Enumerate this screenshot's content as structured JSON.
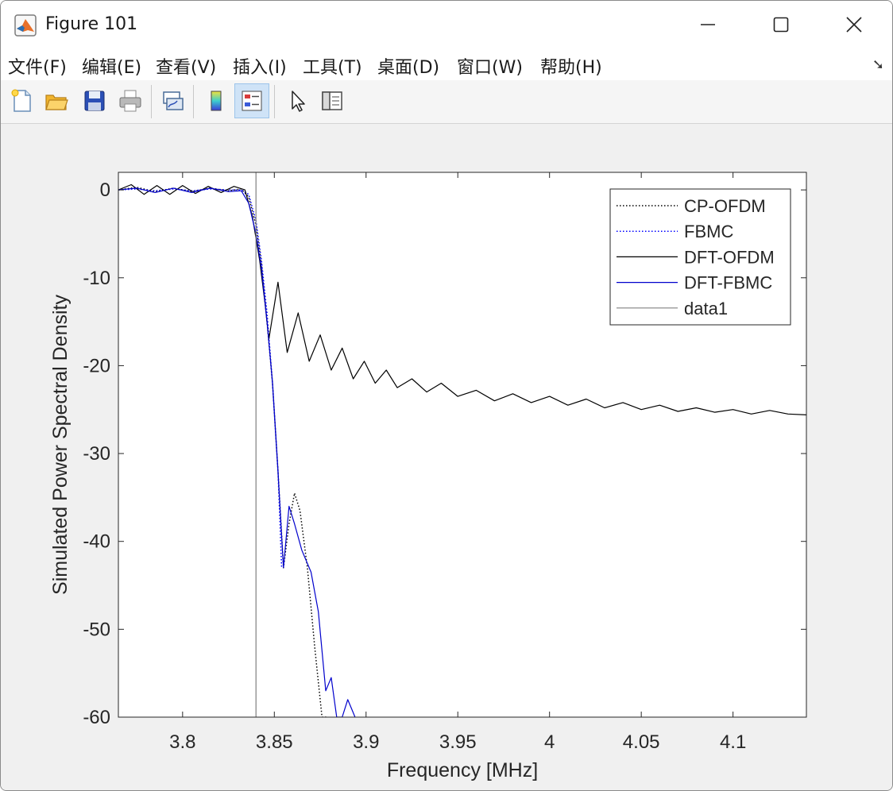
{
  "window": {
    "title": "Figure 101"
  },
  "menu": {
    "items": [
      {
        "label": "文件(F)"
      },
      {
        "label": "编辑(E)"
      },
      {
        "label": "查看(V)"
      },
      {
        "label": "插入(I)"
      },
      {
        "label": "工具(T)"
      },
      {
        "label": "桌面(D)"
      },
      {
        "label": "窗口(W)"
      },
      {
        "label": "帮助(H)"
      }
    ]
  },
  "toolbar": {
    "buttons": [
      "new-figure-icon",
      "open-file-icon",
      "save-icon",
      "print-icon",
      "link-plot-icon",
      "insert-colorbar-icon",
      "insert-legend-icon",
      "edit-plot-icon",
      "property-inspector-icon"
    ],
    "active": "insert-legend-icon"
  },
  "chart_data": {
    "type": "line",
    "xlabel": "Frequency [MHz]",
    "ylabel": "Simulated Power Spectral Density",
    "xlim": [
      3.765,
      4.14
    ],
    "ylim": [
      -60,
      2
    ],
    "xticks": [
      3.8,
      3.85,
      3.9,
      3.95,
      4,
      4.05,
      4.1
    ],
    "xtick_labels": [
      "3.8",
      "3.85",
      "3.9",
      "3.95",
      "4",
      "4.05",
      "4.1"
    ],
    "yticks": [
      0,
      -10,
      -20,
      -30,
      -40,
      -50,
      -60
    ],
    "ytick_labels": [
      "0",
      "-10",
      "-20",
      "-30",
      "-40",
      "-50",
      "-60"
    ],
    "grid": false,
    "legend": {
      "placement": "top-right"
    },
    "series": [
      {
        "name": "CP-OFDM",
        "color": "#000000",
        "style": "dotted",
        "x": [
          3.765,
          3.775,
          3.785,
          3.795,
          3.805,
          3.815,
          3.825,
          3.832,
          3.836,
          3.84,
          3.843,
          3.846,
          3.849,
          3.852,
          3.855,
          3.858,
          3.861,
          3.864,
          3.868,
          3.872,
          3.876,
          3.879
        ],
        "y": [
          0,
          0.3,
          -0.2,
          0.2,
          -0.2,
          0.2,
          -0.1,
          0.1,
          -0.8,
          -4,
          -8.5,
          -15,
          -22,
          -32,
          -43,
          -38,
          -34.5,
          -36.5,
          -43,
          -52,
          -60,
          -60
        ]
      },
      {
        "name": "FBMC",
        "color": "#0000ff",
        "style": "dotted",
        "x": [
          3.765,
          3.775,
          3.785,
          3.795,
          3.805,
          3.815,
          3.825,
          3.832,
          3.836,
          3.84,
          3.843,
          3.846,
          3.849,
          3.852,
          3.854
        ],
        "y": [
          0,
          0.1,
          -0.1,
          0.1,
          -0.1,
          0.1,
          0,
          0,
          -0.5,
          -3.5,
          -8,
          -14,
          -22,
          -32,
          -43
        ]
      },
      {
        "name": "DFT-OFDM",
        "color": "#000000",
        "style": "solid",
        "x": [
          3.765,
          3.772,
          3.779,
          3.786,
          3.793,
          3.8,
          3.807,
          3.814,
          3.821,
          3.828,
          3.834,
          3.838,
          3.842,
          3.845,
          3.847,
          3.852,
          3.857,
          3.863,
          3.869,
          3.875,
          3.881,
          3.887,
          3.893,
          3.899,
          3.905,
          3.911,
          3.917,
          3.925,
          3.933,
          3.941,
          3.95,
          3.96,
          3.97,
          3.98,
          3.99,
          4.0,
          4.01,
          4.02,
          4.03,
          4.04,
          4.05,
          4.06,
          4.07,
          4.08,
          4.09,
          4.1,
          4.11,
          4.12,
          4.13,
          4.14
        ],
        "y": [
          0,
          0.6,
          -0.5,
          0.5,
          -0.5,
          0.5,
          -0.4,
          0.4,
          -0.3,
          0.4,
          0,
          -3,
          -8,
          -13,
          -17,
          -10.5,
          -18.5,
          -14,
          -19.5,
          -16.5,
          -20.5,
          -18,
          -21.5,
          -19.5,
          -22,
          -20.5,
          -22.5,
          -21.5,
          -23,
          -22,
          -23.5,
          -22.8,
          -24,
          -23.2,
          -24.2,
          -23.5,
          -24.5,
          -23.8,
          -24.8,
          -24.2,
          -25,
          -24.5,
          -25.2,
          -24.8,
          -25.3,
          -25,
          -25.5,
          -25.1,
          -25.5,
          -25.6
        ]
      },
      {
        "name": "DFT-FBMC",
        "color": "#0000cc",
        "style": "solid",
        "x": [
          3.765,
          3.775,
          3.785,
          3.795,
          3.805,
          3.815,
          3.825,
          3.832,
          3.836,
          3.84,
          3.843,
          3.846,
          3.849,
          3.852,
          3.855,
          3.858,
          3.861,
          3.865,
          3.87,
          3.874,
          3.878,
          3.881,
          3.884,
          3.887,
          3.89,
          3.892,
          3.894
        ],
        "y": [
          0,
          0.2,
          -0.3,
          0.2,
          -0.3,
          0.2,
          -0.2,
          -0.1,
          -1.5,
          -5,
          -9,
          -15,
          -22,
          -32,
          -43,
          -36,
          -38,
          -41,
          -43.5,
          -48,
          -57,
          -55.5,
          -60,
          -60,
          -58,
          -59,
          -60
        ]
      },
      {
        "name": "data1",
        "color": "#808080",
        "style": "solid",
        "x": [
          3.84,
          3.84
        ],
        "y": [
          2,
          -60
        ]
      }
    ]
  }
}
